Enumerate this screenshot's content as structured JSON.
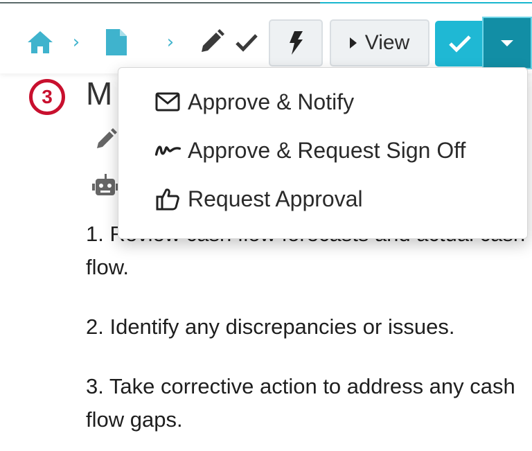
{
  "toolbar": {
    "breadcrumb_separator": "›",
    "view_label": "View",
    "icons": [
      "home-icon",
      "document-icon",
      "pencil-icon",
      "check-icon",
      "bolt-icon",
      "caret-right-icon",
      "check-icon",
      "caret-down-icon"
    ]
  },
  "colors": {
    "accent": "#1fb8d4",
    "accent_dark": "#128ea5",
    "breadcrumb_icon": "#3fb3cd",
    "badge_red": "#c8102e"
  },
  "step": {
    "number": "3",
    "title": "M"
  },
  "dropdown": {
    "items": [
      {
        "label": "Approve & Notify",
        "icon": "envelope-icon"
      },
      {
        "label": "Approve & Request Sign Off",
        "icon": "signature-icon"
      },
      {
        "label": "Request Approval",
        "icon": "thumbs-up-icon"
      }
    ]
  },
  "content": {
    "steps": [
      "1. Review cash flow forecasts and actual cash flow.",
      "2. Identify any discrepancies or issues.",
      "3. Take corrective action to address any cash flow gaps."
    ]
  }
}
